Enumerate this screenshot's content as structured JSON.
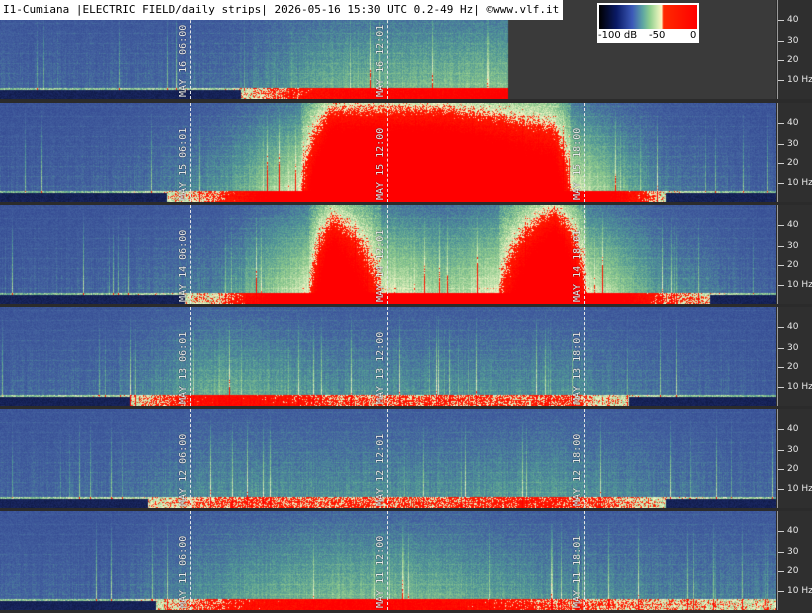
{
  "header": {
    "title": "I1-Cumiana |ELECTRIC FIELD/daily strips| 2026-05-16 15:30 UTC 0.2-49 Hz| ©www.vlf.it"
  },
  "colorbar": {
    "labels": [
      "-100 dB",
      "-50",
      "0"
    ]
  },
  "frequency_scale": {
    "labels": [
      "40",
      "30",
      "20",
      "10 Hz"
    ]
  },
  "strips": [
    {
      "name": "may-16",
      "markers": [
        "MAY 16 06:00",
        "MAY 16 12:01"
      ],
      "activity": [
        0.1,
        0.1,
        0.15,
        0.45,
        0.5,
        0.55,
        0.5,
        0.5
      ],
      "partial_until": 0.655
    },
    {
      "name": "may-15",
      "markers": [
        "MAY 15 06:01",
        "MAY 15 12:00",
        "MAY 15 18:00"
      ],
      "activity": [
        0.05,
        0.1,
        0.3,
        1.0,
        1.0,
        0.9,
        0.2,
        0.05
      ]
    },
    {
      "name": "may-14",
      "markers": [
        "MAY 14 06:00",
        "MAY 14 12:01",
        "MAY 14 18:01"
      ],
      "activity": [
        0.05,
        0.1,
        0.25,
        0.95,
        0.6,
        1.0,
        0.3,
        0.05
      ]
    },
    {
      "name": "may-13",
      "markers": [
        "MAY 13 06:01",
        "MAY 13 12:00",
        "MAY 13 18:01"
      ],
      "activity": [
        0.1,
        0.15,
        0.45,
        0.3,
        0.3,
        0.3,
        0.15,
        0.05
      ]
    },
    {
      "name": "may-12",
      "markers": [
        "MAY 12 06:00",
        "MAY 12 12:01",
        "MAY 12 18:00"
      ],
      "activity": [
        0.1,
        0.15,
        0.3,
        0.3,
        0.3,
        0.35,
        0.2,
        0.1
      ]
    },
    {
      "name": "may-11",
      "markers": [
        "MAY 11 06:00",
        "MAY 11 12:00",
        "MAY 11 18:01"
      ],
      "activity": [
        0.1,
        0.1,
        0.35,
        0.5,
        0.45,
        0.3,
        0.25,
        0.2
      ]
    }
  ]
}
